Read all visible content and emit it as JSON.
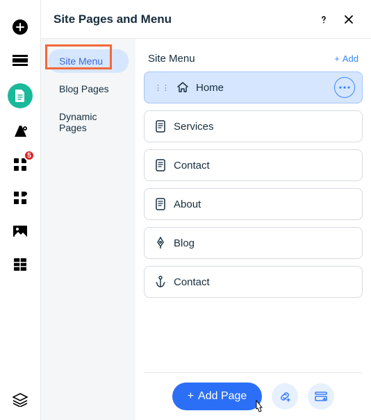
{
  "panel_title": "Site Pages and Menu",
  "rail": {
    "apps_badge": "5"
  },
  "sidebar": {
    "items": [
      {
        "label": "Site Menu"
      },
      {
        "label": "Blog Pages"
      },
      {
        "label": "Dynamic Pages"
      }
    ]
  },
  "section": {
    "title": "Site Menu",
    "add_label": "Add"
  },
  "pages": [
    {
      "label": "Home",
      "icon": "home",
      "selected": true
    },
    {
      "label": "Services",
      "icon": "page",
      "selected": false
    },
    {
      "label": "Contact",
      "icon": "page",
      "selected": false
    },
    {
      "label": "About",
      "icon": "page",
      "selected": false
    },
    {
      "label": "Blog",
      "icon": "pen",
      "selected": false
    },
    {
      "label": "Contact",
      "icon": "anchor",
      "selected": false
    }
  ],
  "footer": {
    "add_page_label": "Add Page"
  }
}
